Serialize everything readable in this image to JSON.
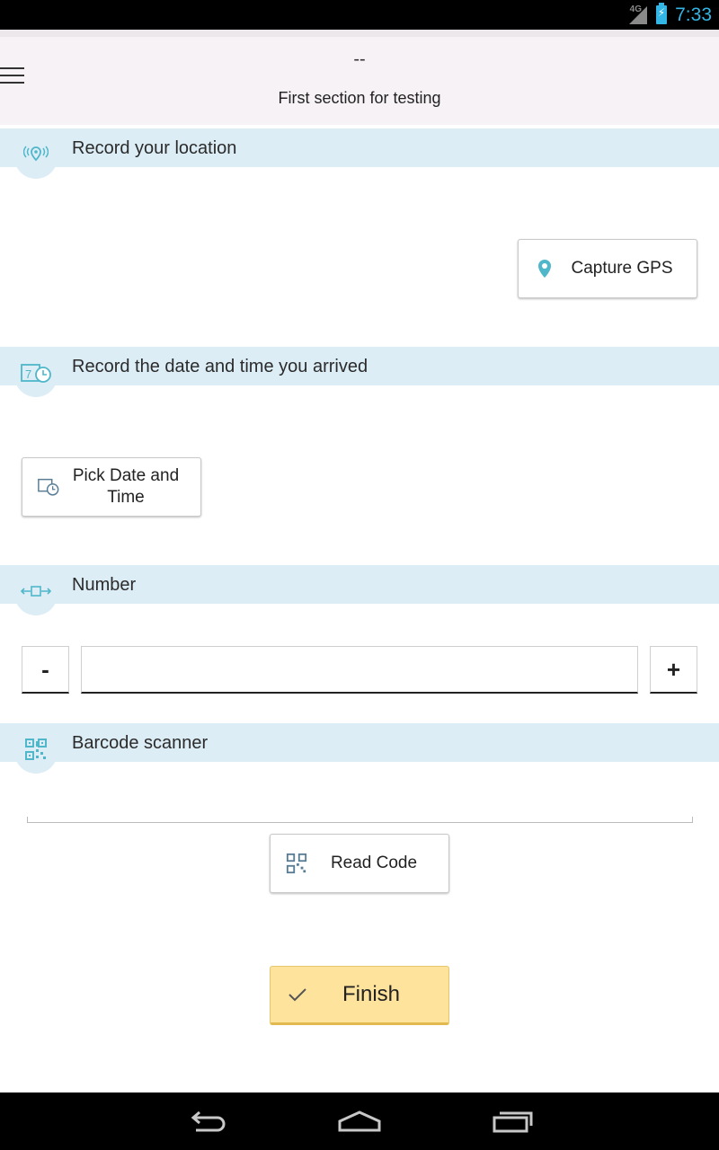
{
  "status_bar": {
    "network": "4G",
    "time": "7:33",
    "accent": "#33b5e5"
  },
  "header": {
    "top_text": "--",
    "section_title": "First section for testing",
    "background": "#f7f2f6"
  },
  "sections": {
    "location": {
      "label": "Record your location",
      "icon": "location-signal-icon",
      "button_label": "Capture GPS",
      "button_icon": "gps-pin-icon"
    },
    "datetime": {
      "label": "Record the date and time you arrived",
      "icon": "calendar-clock-icon",
      "button_label": "Pick Date and Time",
      "button_icon": "calendar-clock-icon"
    },
    "number": {
      "label": "Number",
      "icon": "number-range-icon",
      "minus_label": "-",
      "plus_label": "+",
      "value": ""
    },
    "barcode": {
      "label": "Barcode scanner",
      "icon": "qr-code-icon",
      "button_label": "Read Code",
      "button_icon": "qr-code-icon"
    }
  },
  "finish": {
    "label": "Finish",
    "icon": "checkmark-icon",
    "color": "#fde39c"
  },
  "section_header_color": "#dcedf6",
  "icon_color": "#4fb7c9",
  "nav_bar": {
    "back": "back-icon",
    "home": "home-icon",
    "recents": "recents-icon"
  }
}
